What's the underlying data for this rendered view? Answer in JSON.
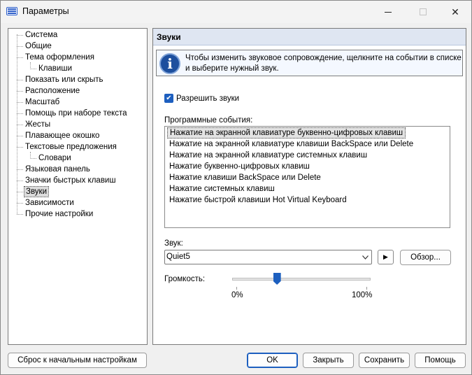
{
  "window": {
    "title": "Параметры"
  },
  "tree": {
    "items": [
      {
        "label": "Система",
        "level": 0
      },
      {
        "label": "Общие",
        "level": 0
      },
      {
        "label": "Тема оформления",
        "level": 0
      },
      {
        "label": "Клавиши",
        "level": 1
      },
      {
        "label": "Показать или скрыть",
        "level": 0
      },
      {
        "label": "Расположение",
        "level": 0
      },
      {
        "label": "Масштаб",
        "level": 0
      },
      {
        "label": "Помощь при наборе текста",
        "level": 0
      },
      {
        "label": "Жесты",
        "level": 0
      },
      {
        "label": "Плавающее окошко",
        "level": 0
      },
      {
        "label": "Текстовые предложения",
        "level": 0
      },
      {
        "label": "Словари",
        "level": 1
      },
      {
        "label": "Языковая панель",
        "level": 0
      },
      {
        "label": "Значки быстрых клавиш",
        "level": 0
      },
      {
        "label": "Звуки",
        "level": 0,
        "selected": true
      },
      {
        "label": "Зависимости",
        "level": 0
      },
      {
        "label": "Прочие настройки",
        "level": 0
      }
    ]
  },
  "panel": {
    "title": "Звуки",
    "info_text": "Чтобы изменить звуковое сопровождение, щелкните на событии в списке и выберите нужный звук.",
    "enable_label": "Разрешить звуки",
    "events_label": "Программные события:",
    "events": [
      "Нажатие на экранной клавиатуре буквенно-цифровых клавиш",
      "Нажатие на экранной клавиатуре клавиши BackSpace или Delete",
      "Нажатие на экранной клавиатуре системных клавиш",
      "Нажатие буквенно-цифровых клавиш",
      "Нажатие клавиши BackSpace или Delete",
      "Нажатие системных клавиш",
      "Нажатие быстрой клавиши Hot Virtual Keyboard"
    ],
    "sound_label": "Звук:",
    "sound_value": "Quiet5",
    "browse_label": "Обзор...",
    "volume_label": "Громкость:",
    "volume_min_label": "0%",
    "volume_max_label": "100%",
    "volume_value_percent": 31
  },
  "buttons": {
    "reset": "Сброс к начальным настройкам",
    "ok": "OK",
    "close": "Закрыть",
    "save": "Сохранить",
    "help": "Помощь"
  },
  "icons": {
    "app": "keyboard-icon",
    "info": "info-icon",
    "check": "checkmark-icon",
    "dropdown": "chevron-down-icon",
    "play": "play-icon"
  }
}
